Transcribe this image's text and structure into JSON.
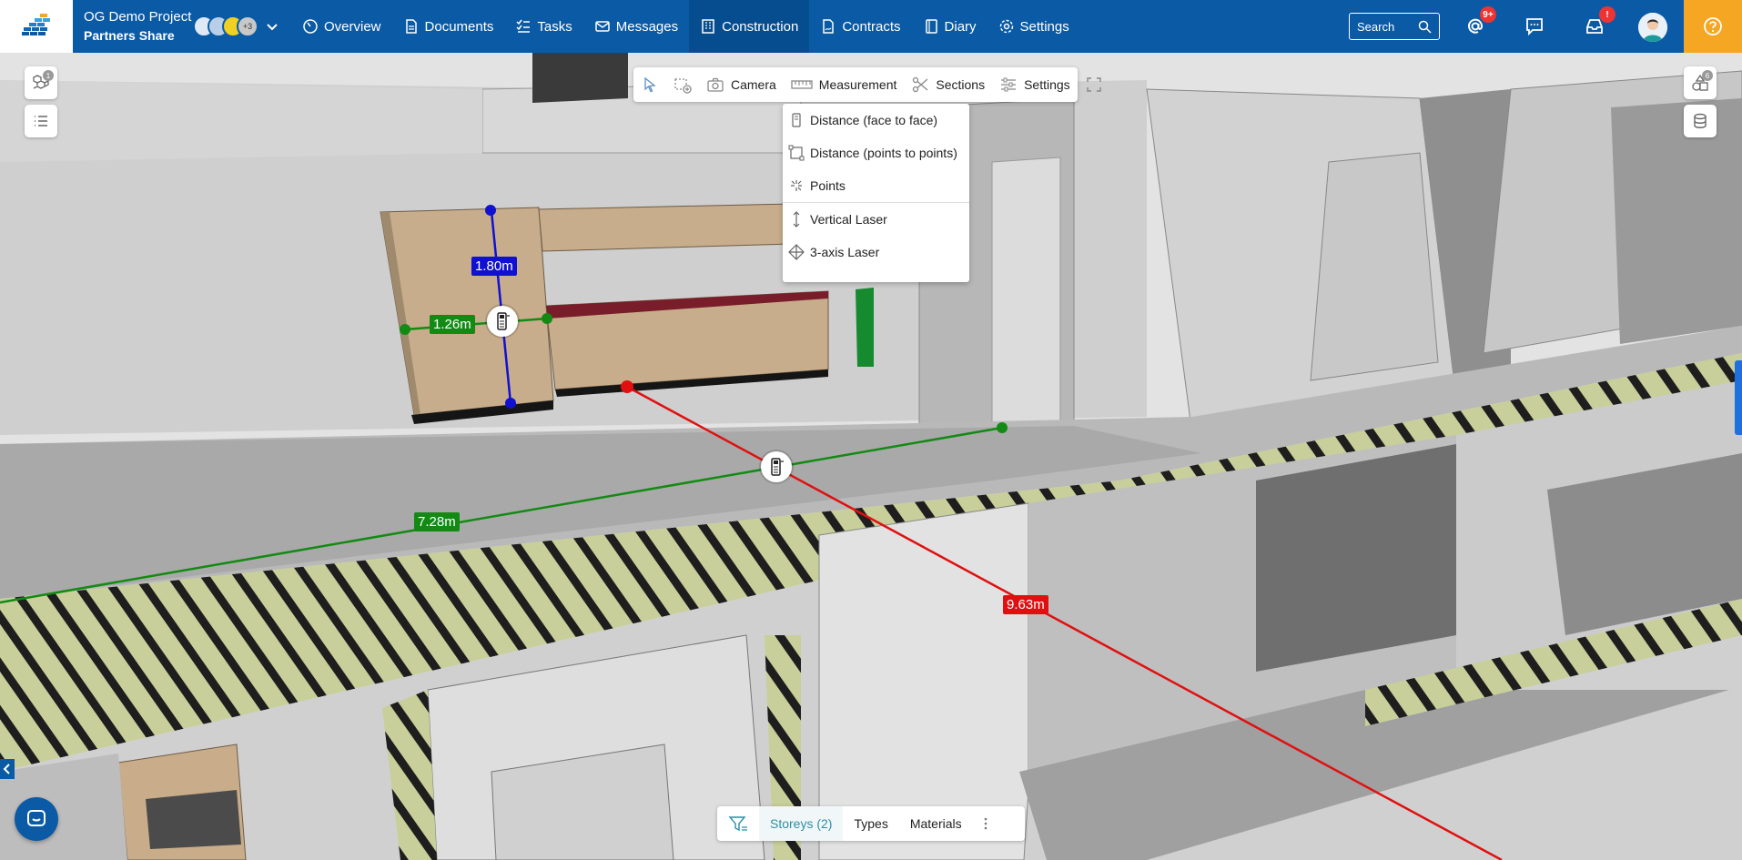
{
  "header": {
    "project_name": "OG Demo Project",
    "project_subtitle": "Partners Share",
    "avatar_more": "+3",
    "nav": [
      {
        "label": "Overview",
        "icon": "gauge-icon"
      },
      {
        "label": "Documents",
        "icon": "document-icon"
      },
      {
        "label": "Tasks",
        "icon": "checklist-icon"
      },
      {
        "label": "Messages",
        "icon": "envelope-icon"
      },
      {
        "label": "Construction",
        "icon": "building-icon",
        "active": true
      },
      {
        "label": "Contracts",
        "icon": "contract-icon"
      },
      {
        "label": "Diary",
        "icon": "book-icon"
      },
      {
        "label": "Settings",
        "icon": "gear-icon"
      }
    ],
    "search_label": "Search",
    "mentions_badge": "9+",
    "inbox_badge": "!",
    "colors": {
      "primary": "#0a5aa5",
      "active": "#064d8f",
      "help": "#f5a623"
    }
  },
  "viewer": {
    "models_count": "1",
    "layers_count": "6",
    "toolbar": {
      "camera": "Camera",
      "measurement": "Measurement",
      "sections": "Sections",
      "settings": "Settings"
    },
    "measure_menu": [
      {
        "label": "Distance (face to face)",
        "icon": "face-distance-icon"
      },
      {
        "label": "Distance (points to points)",
        "icon": "point-distance-icon"
      },
      {
        "label": "Points",
        "icon": "points-icon"
      },
      {
        "label": "Vertical Laser",
        "icon": "vertical-laser-icon"
      },
      {
        "label": "3-axis Laser",
        "icon": "three-axis-laser-icon"
      }
    ],
    "measurements": {
      "blue": "1.80m",
      "green_small": "1.26m",
      "green_long": "7.28m",
      "red": "9.63m"
    },
    "measure_colors": {
      "blue": "#1010d0",
      "green": "#138a13",
      "red": "#e01010"
    },
    "filter_bar": {
      "storeys": "Storeys (2)",
      "types": "Types",
      "materials": "Materials"
    }
  }
}
